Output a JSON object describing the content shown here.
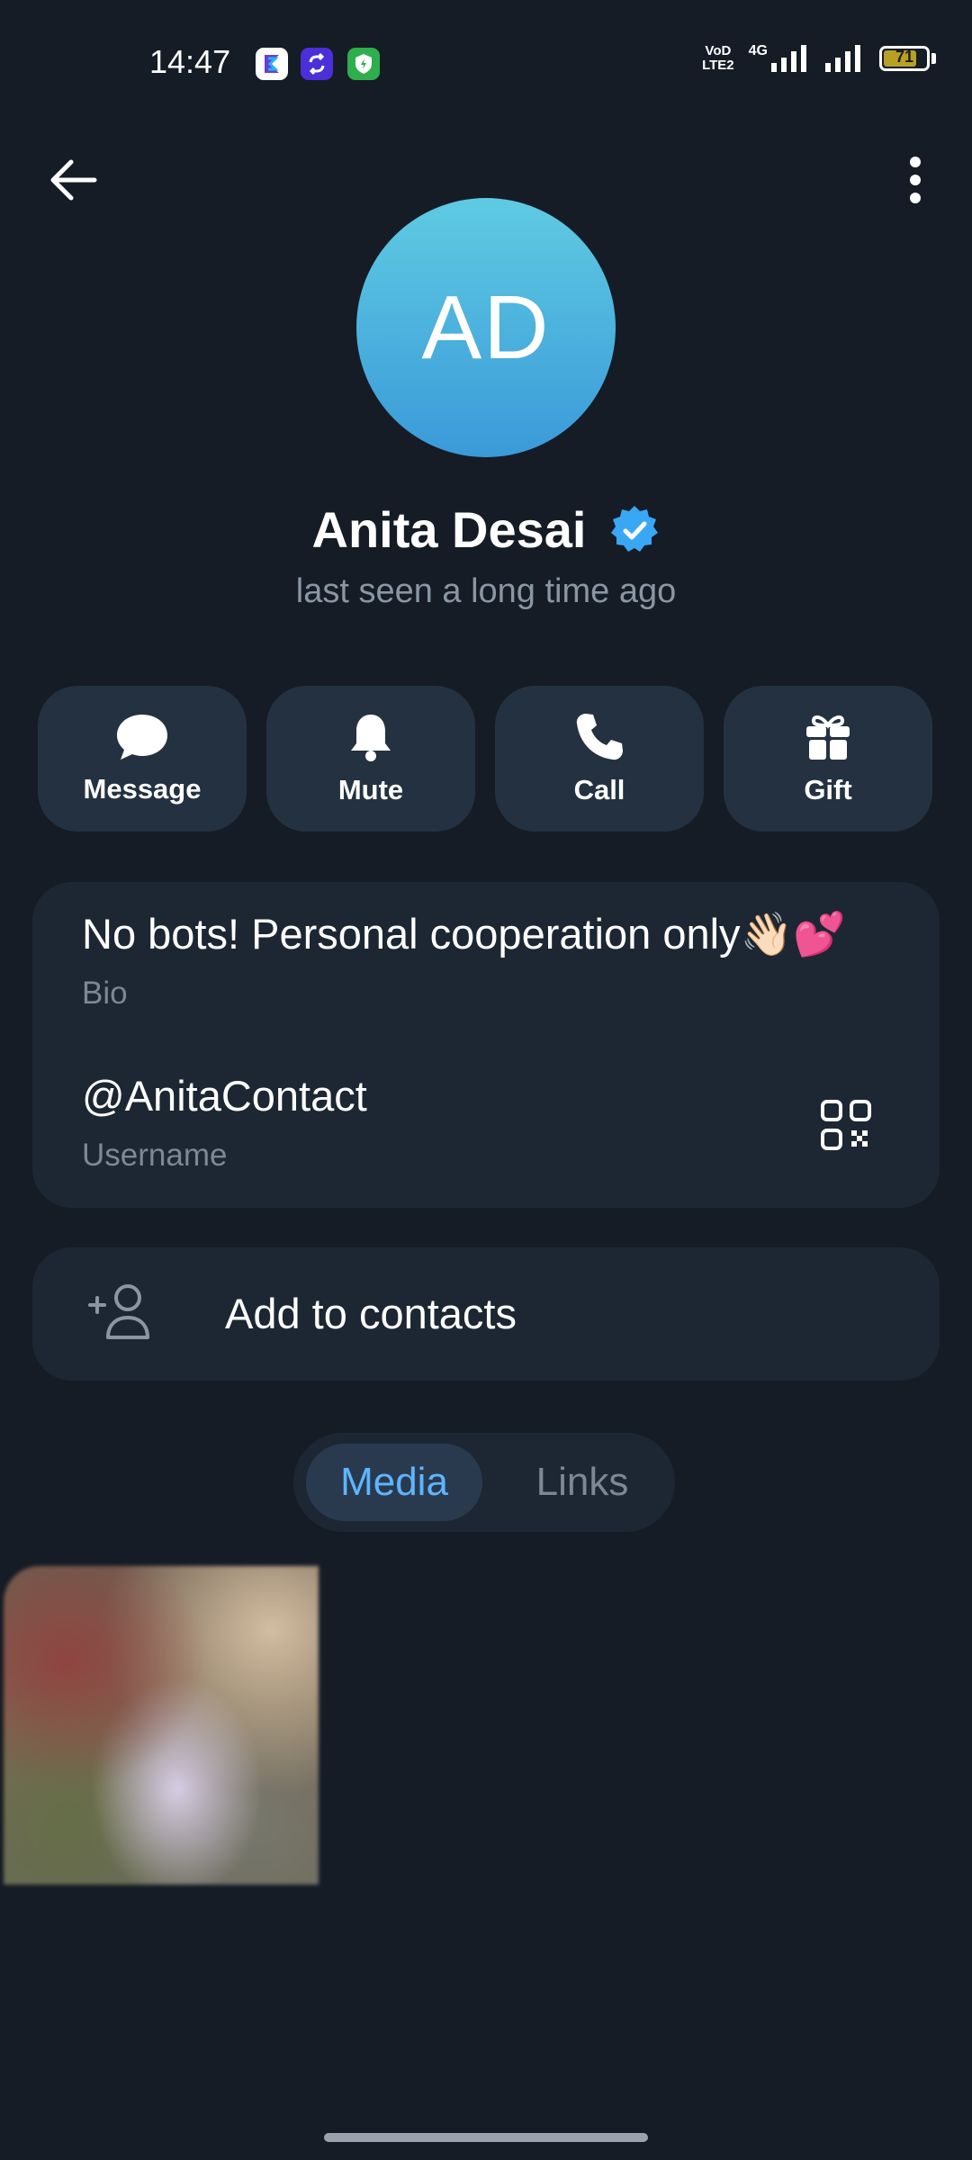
{
  "status_bar": {
    "time": "14:47",
    "network_label_top": "VoD",
    "network_label_bottom": "LTE2",
    "network_type": "4G",
    "battery": "71"
  },
  "nav": {
    "back_icon": "arrow-left-icon",
    "more_icon": "more-vertical-icon"
  },
  "profile": {
    "initials": "AD",
    "name": "Anita Desai",
    "verified_icon": "verified-badge-icon",
    "status": "last seen a long time ago"
  },
  "actions": [
    {
      "label": "Message",
      "icon": "message-bubble-icon"
    },
    {
      "label": "Mute",
      "icon": "bell-icon"
    },
    {
      "label": "Call",
      "icon": "phone-icon"
    },
    {
      "label": "Gift",
      "icon": "gift-icon"
    }
  ],
  "info": {
    "bio": "No bots! Personal cooperation only👋🏻💕",
    "bio_label": "Bio",
    "username": "@AnitaContact",
    "username_label": "Username"
  },
  "add_contact": {
    "label": "Add to contacts"
  },
  "tabs": {
    "media": "Media",
    "links": "Links",
    "active": "Media"
  },
  "colors": {
    "background": "#151c25",
    "card": "#1d2733",
    "button": "#243140",
    "accent": "#5db5ff",
    "avatar_top": "#5fcbe2",
    "avatar_bottom": "#3a9ad9"
  }
}
